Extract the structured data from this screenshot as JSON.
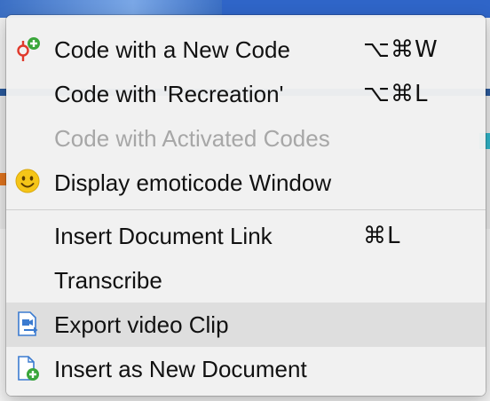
{
  "menu": {
    "groups": [
      [
        {
          "label": "Code with a New Code",
          "shortcut": "⌥⌘W",
          "icon": "code-new-icon",
          "enabled": true
        },
        {
          "label": "Code with 'Recreation'",
          "shortcut": "⌥⌘L",
          "icon": null,
          "enabled": true
        },
        {
          "label": "Code with Activated Codes",
          "shortcut": "",
          "icon": null,
          "enabled": false
        },
        {
          "label": "Display emoticode Window",
          "shortcut": "",
          "icon": "smiley-icon",
          "enabled": true
        }
      ],
      [
        {
          "label": "Insert Document Link",
          "shortcut": "⌘L",
          "icon": null,
          "enabled": true
        },
        {
          "label": "Transcribe",
          "shortcut": "",
          "icon": null,
          "enabled": true
        },
        {
          "label": "Export video Clip",
          "shortcut": "",
          "icon": "export-video-icon",
          "enabled": true,
          "highlighted": true
        },
        {
          "label": "Insert as New Document",
          "shortcut": "",
          "icon": "new-document-icon",
          "enabled": true
        }
      ]
    ]
  },
  "colors": {
    "highlight": "#dedede",
    "disabled_text": "#a7a7a7",
    "code_icon_red": "#e0392b",
    "plus_green": "#3aa63a",
    "smiley_yellow": "#f5c518",
    "doc_blue": "#3b7bd0"
  }
}
